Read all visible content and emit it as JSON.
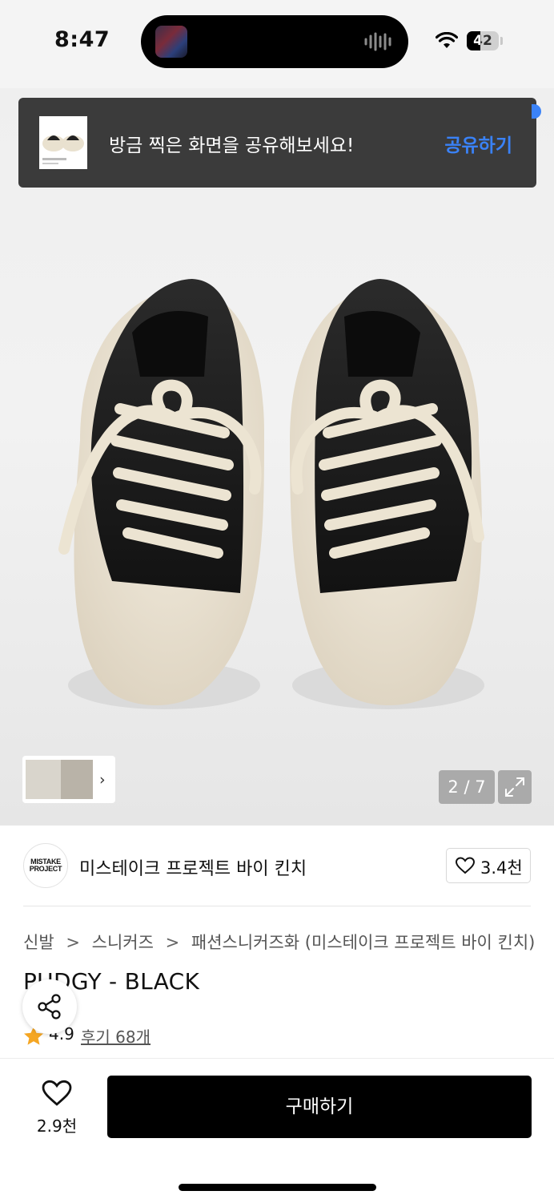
{
  "status_bar": {
    "time": "8:47",
    "battery": "42",
    "battery_level": 0.42
  },
  "toast": {
    "message": "방금 찍은 화면을 공유해보세요!",
    "action": "공유하기"
  },
  "gallery": {
    "counter": "2 / 7"
  },
  "brand": {
    "logo_line1": "MISTAKE",
    "logo_line2": "PROJECT",
    "name": "미스테이크 프로젝트 바이 킨치",
    "likes": "3.4천"
  },
  "breadcrumb": {
    "items": [
      "신발",
      "스니커즈",
      "패션스니커즈화 (미스테이크 프로젝트 바이 킨치)"
    ],
    "separator": ">"
  },
  "product": {
    "title": "PUDGY - BLACK",
    "rating": "4.9",
    "reviews": "후기 68개"
  },
  "bottom": {
    "wish_count": "2.9천",
    "buy_label": "구매하기"
  },
  "colors": {
    "accent_blue": "#3a82f7",
    "star": "#f5a623",
    "button": "#000000"
  }
}
